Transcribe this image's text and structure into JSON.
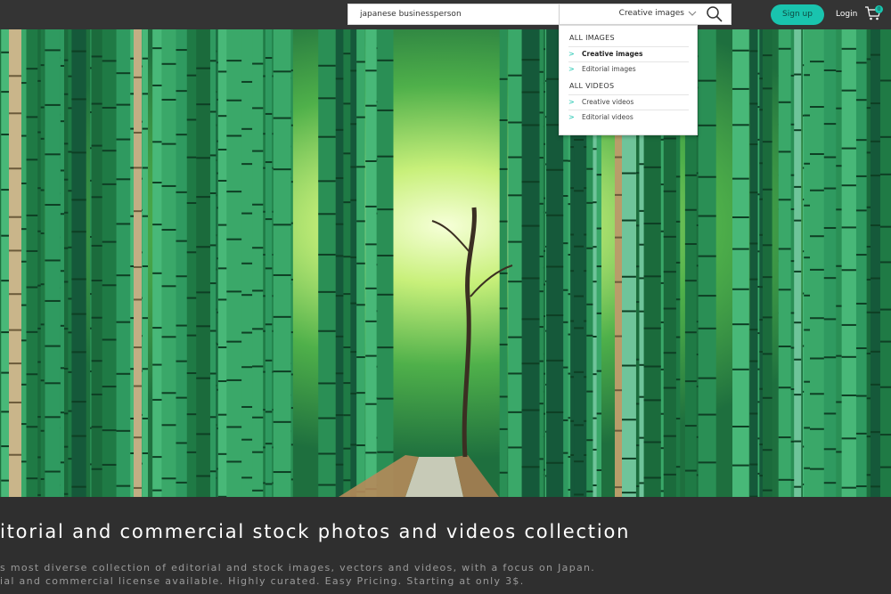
{
  "search": {
    "query": "japanese businessperson",
    "type_selected": "Creative images",
    "search_icon": "search-icon",
    "chevron_icon": "chevron-down-icon"
  },
  "header": {
    "signup_label": "Sign up",
    "login_label": "Login",
    "cart_icon": "cart-icon",
    "cart_count": "0"
  },
  "dropdown": {
    "groups": [
      {
        "heading": "ALL IMAGES",
        "items": [
          {
            "label": "Creative images",
            "active": true
          },
          {
            "label": "Editorial images",
            "active": false
          }
        ]
      },
      {
        "heading": "ALL VIDEOS",
        "items": [
          {
            "label": "Creative videos",
            "active": false
          },
          {
            "label": "Editorial videos",
            "active": false
          }
        ]
      }
    ],
    "arrow_glyph": ">"
  },
  "hero": {
    "image": "bamboo-forest-path"
  },
  "intro": {
    "headline": "itorial and commercial stock photos and videos collection",
    "line1": "s most diverse collection of editorial and stock images, vectors and videos, with a focus on Japan.",
    "line2": "ial and commercial license available. Highly curated. Easy Pricing. Starting at only 3$."
  },
  "colors": {
    "accent": "#19c4ae",
    "topbar": "#343434",
    "background": "#2f2f2f"
  }
}
